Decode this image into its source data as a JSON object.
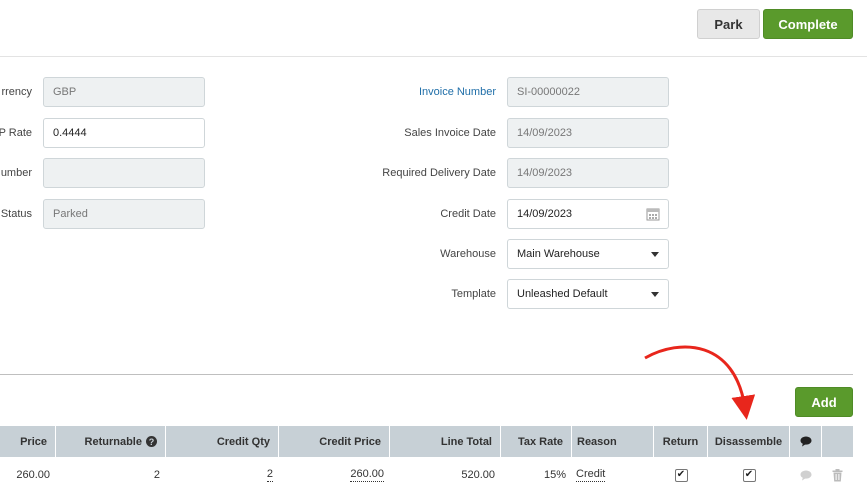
{
  "toolbar": {
    "park_label": "Park",
    "complete_label": "Complete",
    "add_label": "Add"
  },
  "left_form": [
    {
      "label": "rrency",
      "value": "GBP"
    },
    {
      "label": "P Rate",
      "value": "0.4444"
    },
    {
      "label": "umber",
      "value": ""
    },
    {
      "label": "Status",
      "value": "Parked"
    }
  ],
  "right_form": [
    {
      "label": "Invoice Number",
      "value": "SI-00000022"
    },
    {
      "label": "Sales Invoice Date",
      "value": "14/09/2023"
    },
    {
      "label": "Required Delivery Date",
      "value": "14/09/2023"
    },
    {
      "label": "Credit Date",
      "value": "14/09/2023"
    },
    {
      "label": "Warehouse",
      "value": "Main Warehouse"
    },
    {
      "label": "Template",
      "value": "Unleashed Default"
    }
  ],
  "table": {
    "headers": {
      "price": "Price",
      "returnable": "Returnable",
      "credit_qty": "Credit Qty",
      "credit_price": "Credit Price",
      "line_total": "Line Total",
      "tax_rate": "Tax Rate",
      "reason": "Reason",
      "return": "Return",
      "disassemble": "Disassemble"
    },
    "rows": [
      {
        "price": "260.00",
        "returnable": "2",
        "credit_qty": "2",
        "credit_price": "260.00",
        "line_total": "520.00",
        "tax_rate": "15%",
        "reason": "Credit",
        "return": "✔",
        "disassemble": "✔"
      }
    ]
  },
  "colors": {
    "accent": "#5a9a2c",
    "link": "#1f6ea8",
    "annotation_arrow": "#e8261c",
    "table_header": "#c7d0d6"
  }
}
